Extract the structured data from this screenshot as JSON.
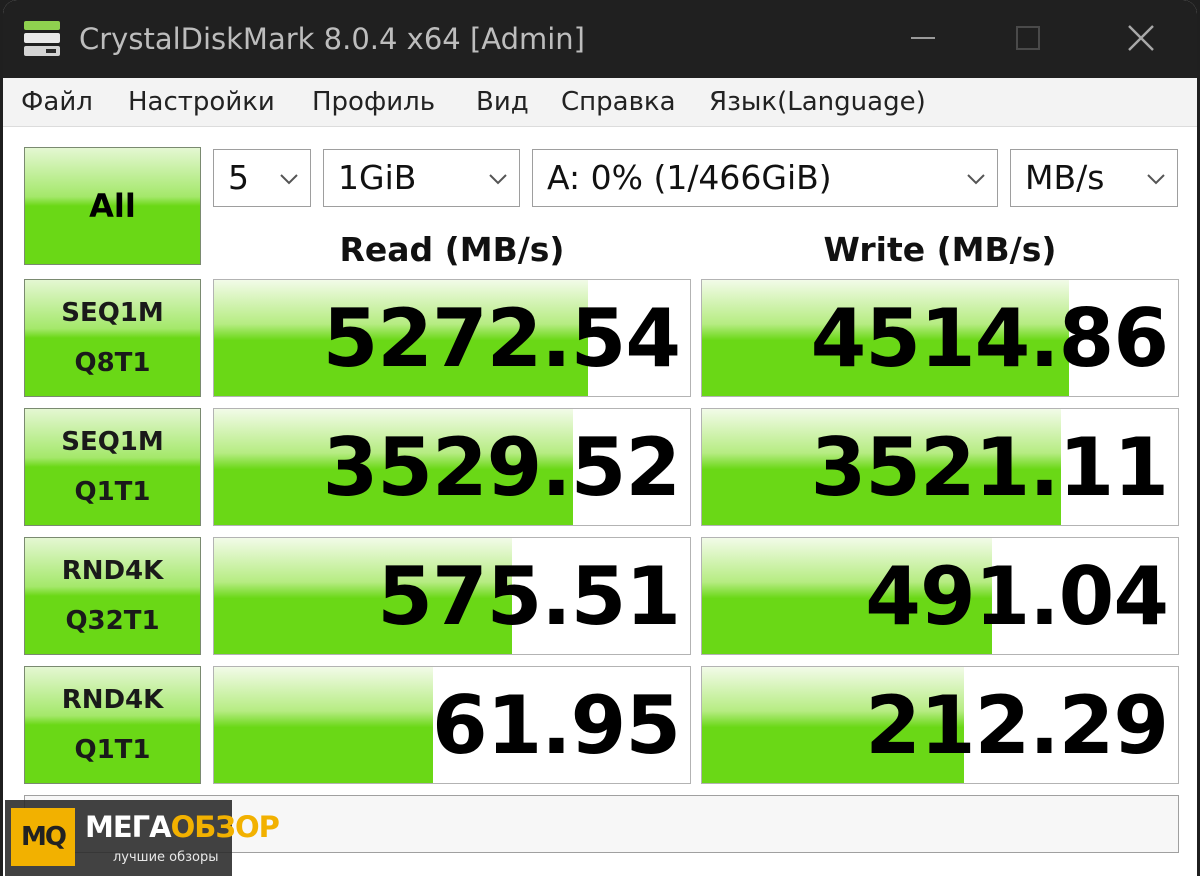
{
  "window": {
    "title": "CrystalDiskMark 8.0.4 x64 [Admin]",
    "app_icon": "disk-icon",
    "controls": {
      "minimize": "minimize-icon",
      "maximize": "maximize-icon",
      "close": "close-icon"
    }
  },
  "menu": [
    "Файл",
    "Настройки",
    "Профиль",
    "Вид",
    "Справка",
    "Язык(Language)"
  ],
  "toolbar": {
    "all_label": "All",
    "count": "5",
    "size": "1GiB",
    "drive": "A: 0% (1/466GiB)",
    "unit": "MB/s"
  },
  "headers": {
    "read": "Read (MB/s)",
    "write": "Write (MB/s)"
  },
  "rows": [
    {
      "line1": "SEQ1M",
      "line2": "Q8T1",
      "read": "5272.54",
      "write": "4514.86",
      "read_fill": 0.785,
      "write_fill": 0.77
    },
    {
      "line1": "SEQ1M",
      "line2": "Q1T1",
      "read": "3529.52",
      "write": "3521.11",
      "read_fill": 0.755,
      "write_fill": 0.755
    },
    {
      "line1": "RND4K",
      "line2": "Q32T1",
      "read": "575.51",
      "write": "491.04",
      "read_fill": 0.625,
      "write_fill": 0.61
    },
    {
      "line1": "RND4K",
      "line2": "Q1T1",
      "read": "61.95",
      "write": "212.29",
      "read_fill": 0.46,
      "write_fill": 0.55
    }
  ],
  "comment": "",
  "watermark": {
    "mark": "MQ",
    "word_main": "МЕГА",
    "word_accent": "ОБЗОР",
    "tagline": "лучшие обзоры"
  },
  "colors": {
    "bar_green": "#6ad816",
    "titlebar": "#202020",
    "panel": "#ffffff"
  }
}
